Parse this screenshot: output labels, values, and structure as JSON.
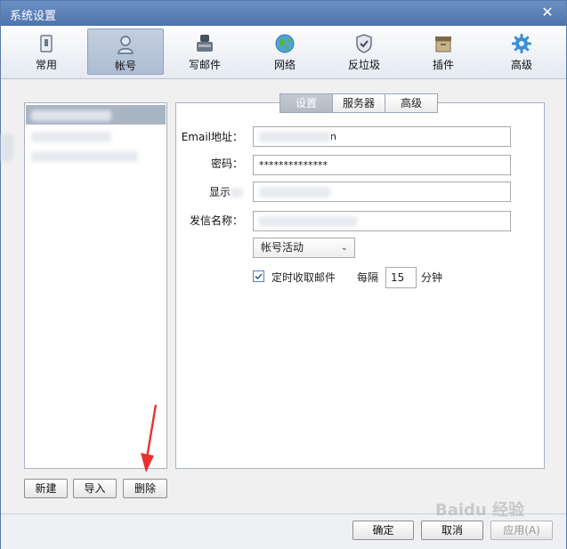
{
  "window": {
    "title": "系统设置",
    "close_glyph": "✕"
  },
  "toolbar": {
    "items": [
      {
        "label": "常用",
        "icon": "general-icon"
      },
      {
        "label": "帐号",
        "icon": "account-icon"
      },
      {
        "label": "写邮件",
        "icon": "compose-icon"
      },
      {
        "label": "网络",
        "icon": "network-icon"
      },
      {
        "label": "反垃圾",
        "icon": "anti-spam-shield-icon"
      },
      {
        "label": "插件",
        "icon": "plugin-icon"
      },
      {
        "label": "高级",
        "icon": "advanced-gear-icon"
      }
    ],
    "active_index": 1
  },
  "accounts": {
    "buttons": {
      "new": "新建",
      "import": "导入",
      "delete": "删除"
    }
  },
  "tabs": [
    {
      "label": "设置"
    },
    {
      "label": "服务器"
    },
    {
      "label": "高级"
    }
  ],
  "form": {
    "email_label": "Email地址：",
    "email_value_suffix": "n",
    "password_label": "密码：",
    "password_value": "**************",
    "display_label": "显示",
    "sender_label": "发信名称：",
    "status_select": "帐号活动",
    "auto_receive_label": "定时收取邮件",
    "auto_receive_checked": true,
    "every_label": "每隔",
    "interval_value": "15",
    "minute_label": "分钟"
  },
  "footer": {
    "ok": "确定",
    "cancel": "取消",
    "apply": "应用(A)"
  },
  "watermark": "Baidu 经验"
}
